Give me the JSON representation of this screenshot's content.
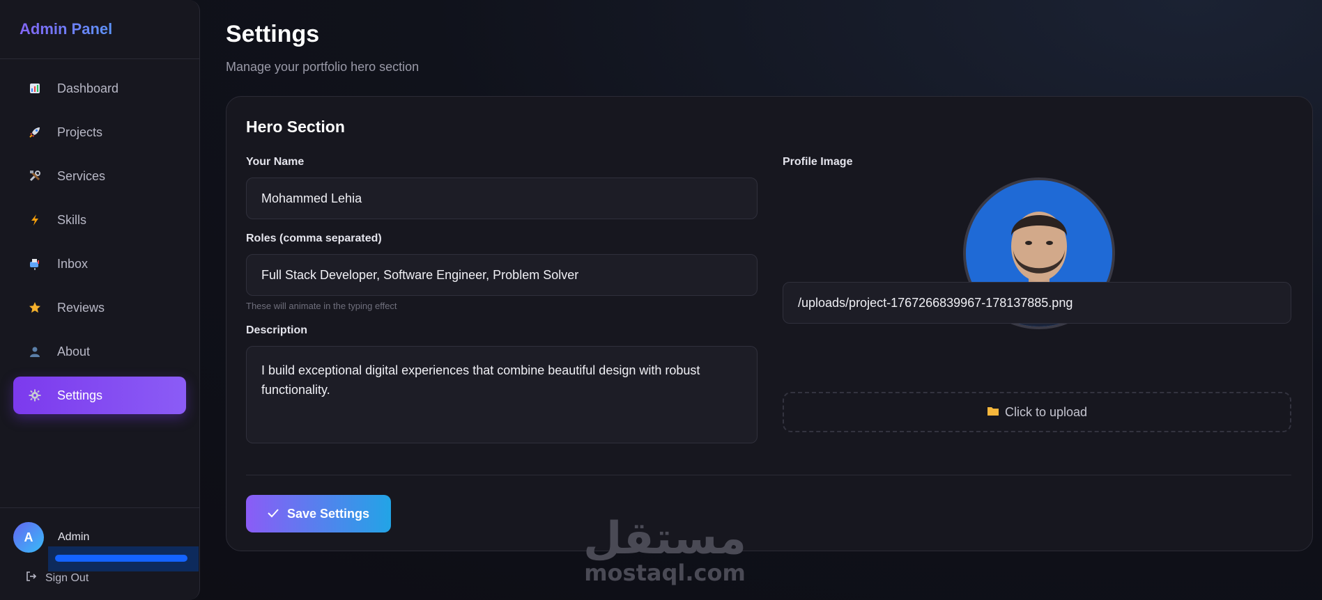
{
  "sidebar": {
    "brand": "Admin Panel",
    "items": [
      {
        "label": "Dashboard",
        "icon": "bar-chart-icon"
      },
      {
        "label": "Projects",
        "icon": "rocket-icon"
      },
      {
        "label": "Services",
        "icon": "tools-icon"
      },
      {
        "label": "Skills",
        "icon": "lightning-icon"
      },
      {
        "label": "Inbox",
        "icon": "mailbox-icon"
      },
      {
        "label": "Reviews",
        "icon": "star-icon"
      },
      {
        "label": "About",
        "icon": "user-icon"
      },
      {
        "label": "Settings",
        "icon": "gear-icon"
      }
    ],
    "active_item": "Settings",
    "user": {
      "initial": "A",
      "name": "Admin"
    },
    "signout_label": "Sign Out"
  },
  "page": {
    "title": "Settings",
    "subtitle": "Manage your portfolio hero section"
  },
  "hero": {
    "title": "Hero Section",
    "name_label": "Your Name",
    "name_value": "Mohammed Lehia",
    "roles_label": "Roles (comma separated)",
    "roles_value": "Full Stack Developer, Software Engineer, Problem Solver",
    "roles_hint": "These will animate in the typing effect",
    "description_label": "Description",
    "description_value": "I build exceptional digital experiences that combine beautiful design with robust functionality.",
    "profile_label": "Profile Image",
    "profile_path": "/uploads/project-1767266839967-178137885.png",
    "upload_label": "Click to upload",
    "save_label": "Save Settings"
  },
  "watermark": {
    "arabic": "مستقل",
    "latin": "mostaql.com"
  },
  "colors": {
    "accent": "#8b5cf6",
    "accent_secondary": "#22a4e6",
    "background": "#0f0f16",
    "card": "#17171f"
  }
}
